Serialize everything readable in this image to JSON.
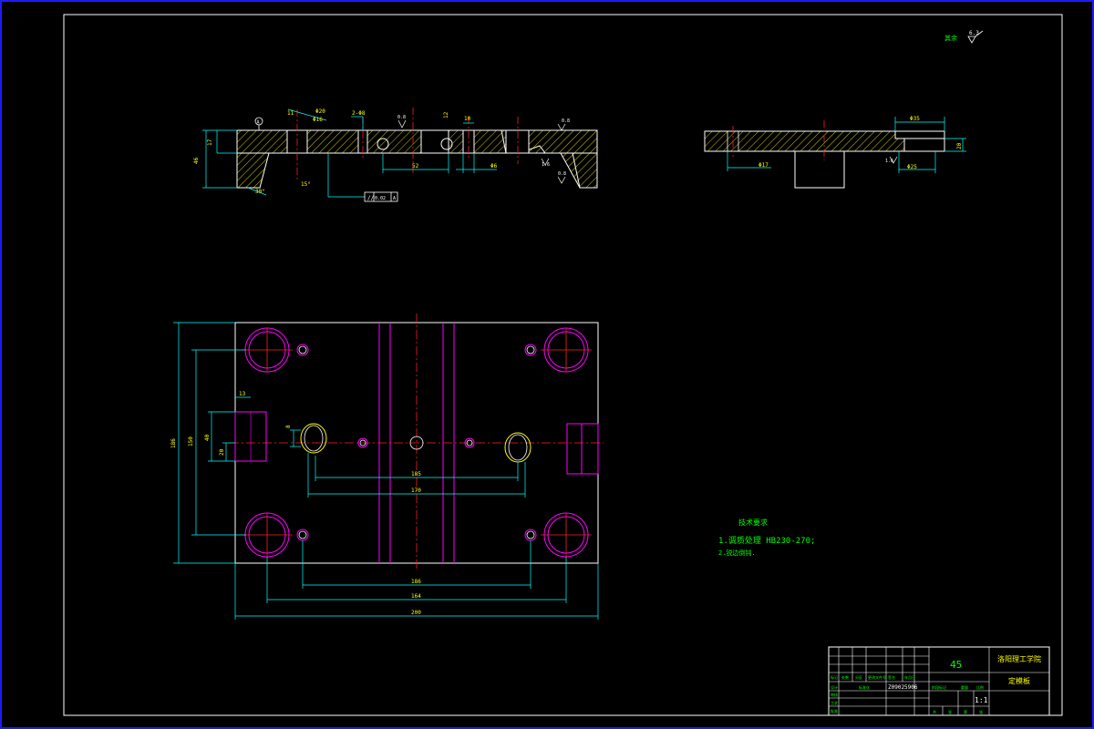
{
  "roughness_note": {
    "label": "其余",
    "value": "6.3"
  },
  "section_view": {
    "labels": {
      "holes": "2-Φ8",
      "phi20": "Φ20",
      "phi16": "Φ16",
      "dim11": "11",
      "dim12": "12",
      "dim10": "10",
      "thick17": "17",
      "height46": "46",
      "dim52": "52",
      "dim6": "Φ6",
      "angle30": "30°",
      "angle15": "15°",
      "datum": "A",
      "rough_08a": "0.8",
      "rough_08b": "0.8",
      "rough_08c": "0.8",
      "rough_16": "1.6",
      "tolerance": "0.02"
    }
  },
  "side_view": {
    "labels": {
      "phi35": "Φ35",
      "phi17": "Φ17",
      "phi25": "Φ25",
      "dim": "20",
      "rough": "1.6"
    }
  },
  "plan_view": {
    "dims": {
      "d200": "200",
      "d164": "164",
      "d186": "186",
      "d185": "185",
      "d170": "170",
      "d150": "150",
      "d40": "40",
      "d13": "13",
      "d20": "20",
      "d8": "8"
    }
  },
  "tech_notes": {
    "title": "技术要求",
    "items": [
      "1.调质处理 HB230-270;",
      "2.锐边倒钝."
    ]
  },
  "title_block": {
    "material": "45",
    "school": "洛阳理工学院",
    "part_name": "定模板",
    "drawing_no": "Z09025906",
    "scale": "1:1",
    "header_cells": [
      "标记",
      "处数",
      "分区",
      "更改文件号",
      "签名",
      "年月日"
    ],
    "row_design": "设计",
    "row_std": "标准化",
    "row_check": "审核",
    "row_process": "工艺",
    "row_approve": "批准",
    "stage_label": "阶段标记",
    "weight_label": "重量",
    "scale_label": "比例",
    "sheet_total": "共",
    "sheet_no": "张",
    "sheet_of": "第",
    "sheet_unit": "张"
  }
}
